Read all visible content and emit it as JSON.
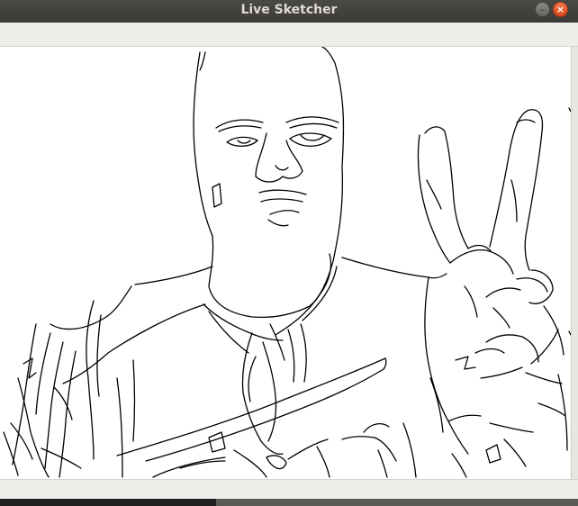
{
  "window": {
    "title": "Live Sketcher",
    "minimize_symbol": "–",
    "close_symbol": "×"
  },
  "canvas": {
    "content": "live-sketch-frame",
    "background": "#ffffff",
    "stroke_color": "#000000"
  },
  "colors": {
    "titlebar": "#3c3b37",
    "title_text": "#dfdbd2",
    "close_button": "#e95420",
    "window_background": "#efede9"
  }
}
